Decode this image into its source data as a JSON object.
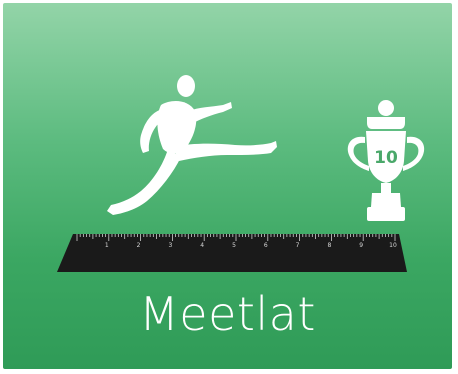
{
  "app": {
    "title": "Meetlat"
  },
  "trophy": {
    "number": "10"
  },
  "ruler": {
    "numbers": [
      "1",
      "2",
      "3",
      "4",
      "5",
      "6",
      "7",
      "8",
      "9",
      "10"
    ]
  },
  "colors": {
    "background_top": "#93d4a8",
    "background_bottom": "#2f9b57",
    "figure": "#ffffff",
    "ruler": "#1a1a1a"
  },
  "icons": [
    "long-jumper-figure-icon",
    "trophy-icon",
    "ruler-icon"
  ]
}
